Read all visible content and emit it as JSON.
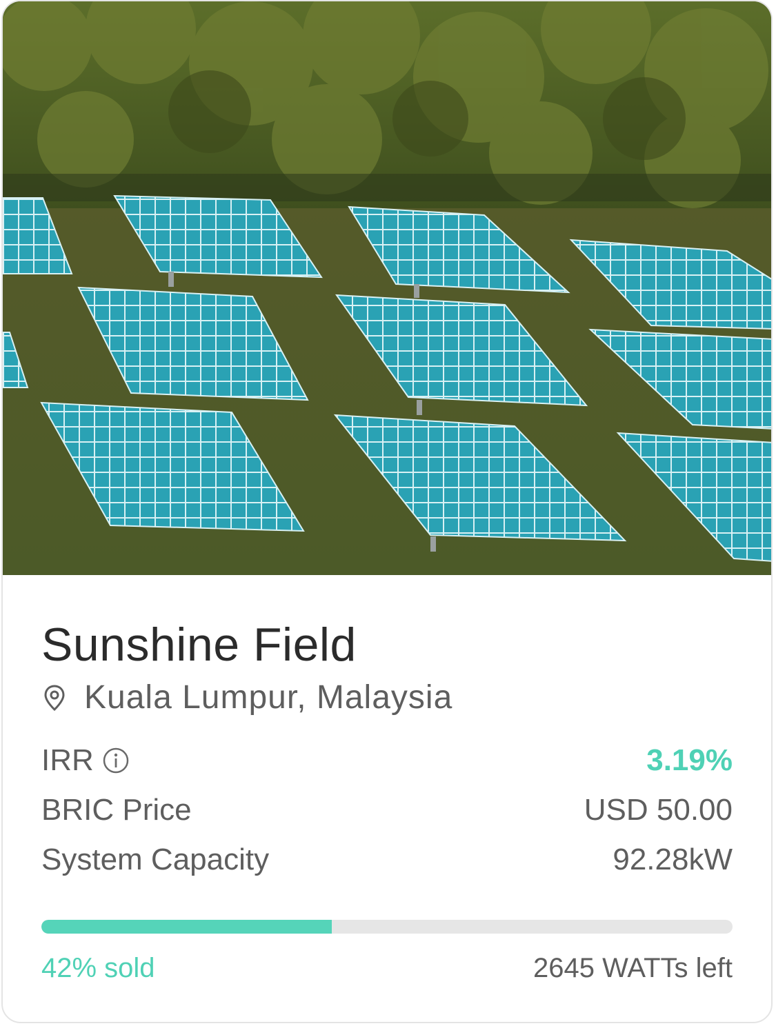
{
  "project": {
    "title": "Sunshine Field",
    "location": "Kuala Lumpur, Malaysia",
    "image_alt": "solar panels on a grassy hillside"
  },
  "metrics": {
    "irr": {
      "label": "IRR",
      "value": "3.19%"
    },
    "price": {
      "label": "BRIC Price",
      "value": "USD 50.00"
    },
    "capacity": {
      "label": "System Capacity",
      "value": "92.28kW"
    }
  },
  "progress": {
    "fraction": 0.42,
    "sold_label": "42% sold",
    "remaining_label": "2645 WATTs left"
  },
  "colors": {
    "accent": "#4fd1b5",
    "panel": "#2aa7b7",
    "text_primary": "#2b2b2b",
    "text_secondary": "#5e5e5e"
  },
  "icons": {
    "location": "location-pin-icon",
    "info": "info-icon"
  }
}
